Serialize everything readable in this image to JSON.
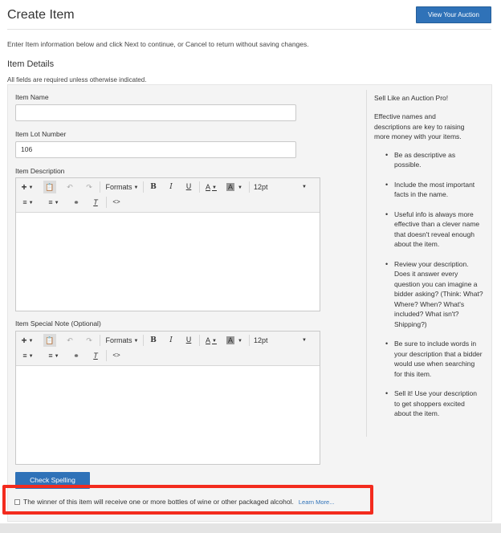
{
  "header": {
    "title": "Create Item",
    "view_auction_label": "View Your Auction"
  },
  "intro_text": "Enter Item information below and click Next to continue, or Cancel to return without saving changes.",
  "section": {
    "title": "Item Details",
    "required_note": "All fields are required unless otherwise indicated."
  },
  "fields": {
    "item_name": {
      "label": "Item Name",
      "value": ""
    },
    "lot_number": {
      "label": "Item Lot Number",
      "value": "106"
    },
    "description": {
      "label": "Item Description"
    },
    "special_note": {
      "label": "Item Special Note (Optional)"
    }
  },
  "toolbar": {
    "formats_label": "Formats",
    "font_size": "12pt",
    "icons": [
      "plus-icon",
      "paste-icon",
      "undo-icon",
      "redo-icon",
      "bold-icon",
      "italic-icon",
      "underline-icon",
      "text-color-icon",
      "background-color-icon",
      "bullet-list-icon",
      "numbered-list-icon",
      "unlink-icon",
      "clear-formatting-icon",
      "source-code-icon"
    ]
  },
  "sidebar": {
    "heading": "Sell Like an Auction Pro!",
    "intro": "Effective names and descriptions are key to raising more money with your items.",
    "tips": [
      "Be as descriptive as possible.",
      "Include the most important facts in the name.",
      "Useful info is always more effective than a clever name that doesn't reveal enough about the item.",
      "Review your description. Does it answer every question you can imagine a bidder asking? (Think: What? Where? When? What's included? What isn't? Shipping?)",
      "Be sure to include words in your description that a bidder would use when searching for this item.",
      "Sell it! Use your description to get shoppers excited about the item."
    ]
  },
  "check_spelling_label": "Check Spelling",
  "alcohol": {
    "checked": false,
    "text": "The winner of this item will receive one or more bottles of wine or other packaged alcohol.",
    "learn_more": "Learn More..."
  },
  "colors": {
    "primary": "#2f72b8",
    "highlight": "#f32b1e"
  }
}
